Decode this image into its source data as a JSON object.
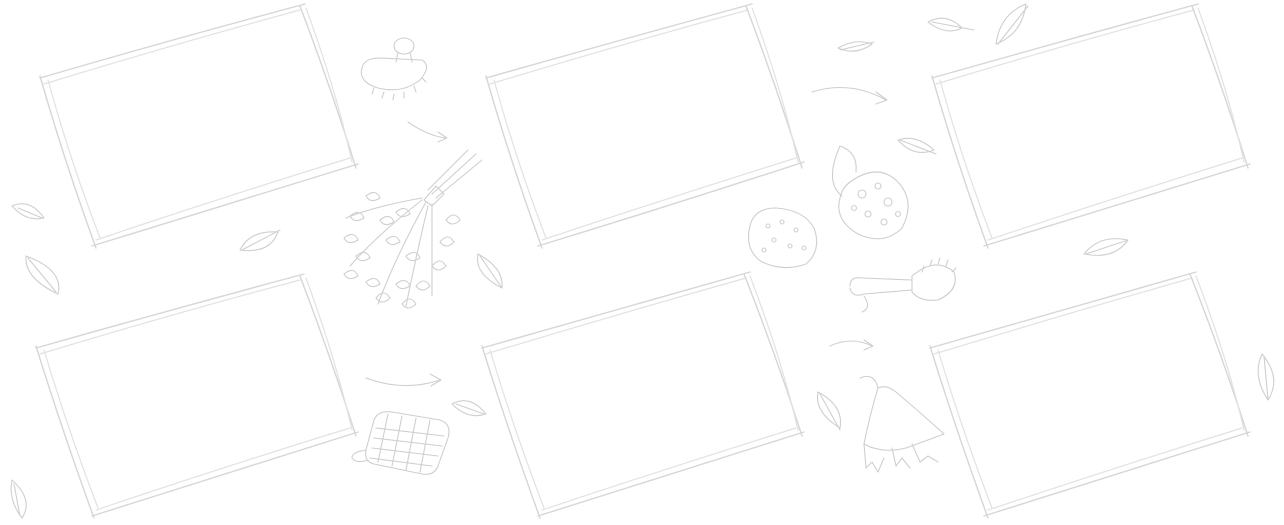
{
  "page": {
    "background": "#ffffff",
    "ink_color": "#d6d6d6"
  },
  "frames": [
    {
      "name": "photo-frame-1"
    },
    {
      "name": "photo-frame-2"
    },
    {
      "name": "photo-frame-3"
    },
    {
      "name": "photo-frame-4"
    },
    {
      "name": "photo-frame-5"
    },
    {
      "name": "photo-frame-6"
    }
  ],
  "doodles": [
    "massage-brush-icon",
    "birch-broom-icon",
    "sponge-icon",
    "loofah-icon",
    "bath-brush-icon",
    "sauna-hat-icon",
    "scrub-mitt-icon",
    "leaf-icon",
    "arrow-icon"
  ]
}
